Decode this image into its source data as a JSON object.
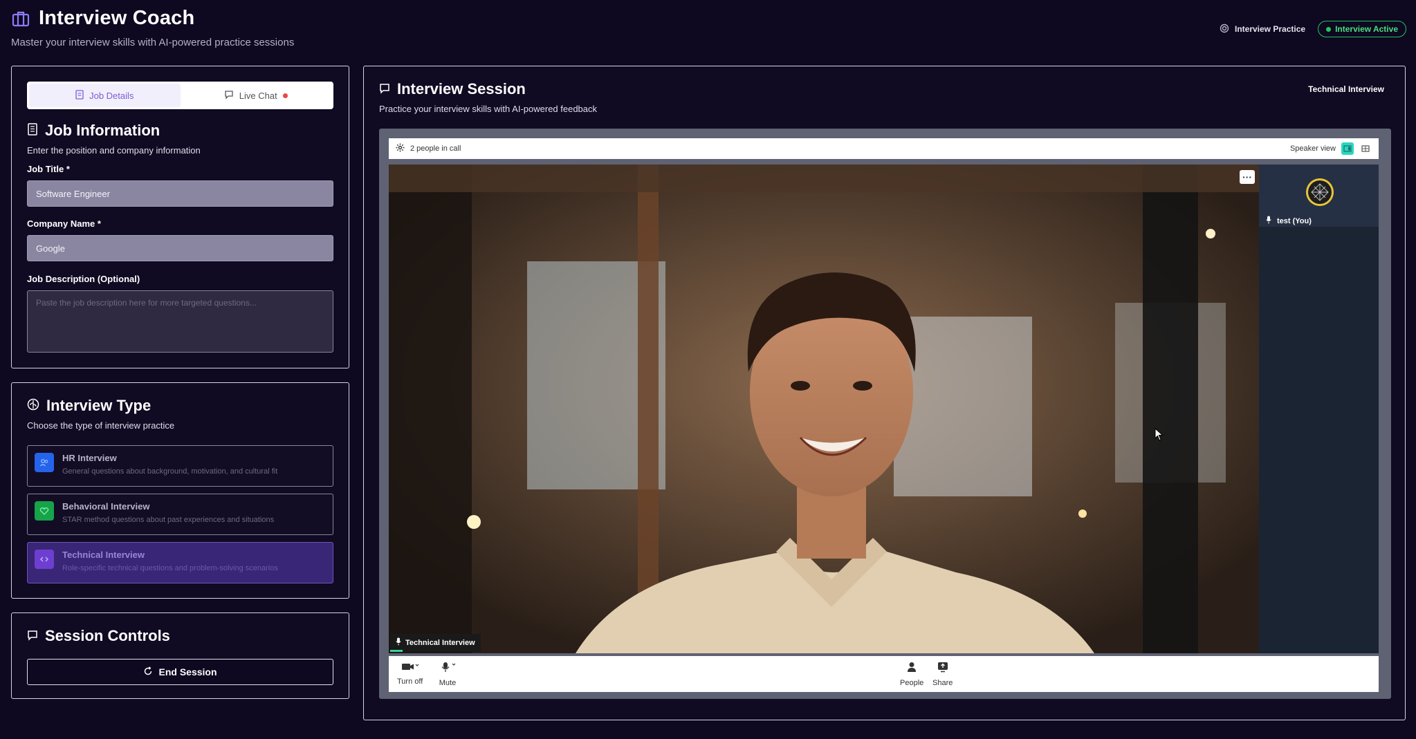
{
  "header": {
    "title": "Interview Coach",
    "subtitle": "Master your interview skills with AI-powered practice sessions",
    "practice_label": "Interview Practice",
    "status_label": "Interview Active"
  },
  "tabs": [
    {
      "label": "Job Details",
      "active": true
    },
    {
      "label": "Live Chat",
      "active": false
    }
  ],
  "job_info": {
    "title": "Job Information",
    "subtitle": "Enter the position and company information",
    "job_title_label": "Job Title *",
    "job_title_value": "Software Engineer",
    "company_label": "Company Name *",
    "company_value": "Google",
    "description_label": "Job Description (Optional)",
    "description_placeholder": "Paste the job description here for more targeted questions..."
  },
  "interview_type": {
    "title": "Interview Type",
    "subtitle": "Choose the type of interview practice",
    "options": [
      {
        "name": "HR Interview",
        "desc": "General questions about background, motivation, and cultural fit",
        "icon": "user-icon",
        "color": "#2563eb",
        "selected": false
      },
      {
        "name": "Behavioral Interview",
        "desc": "STAR method questions about past experiences and situations",
        "icon": "heart-icon",
        "color": "#16a34a",
        "selected": false
      },
      {
        "name": "Technical Interview",
        "desc": "Role-specific technical questions and problem-solving scenarios",
        "icon": "code-icon",
        "color": "#7c3aed",
        "selected": true
      }
    ]
  },
  "session_controls": {
    "title": "Session Controls",
    "end_label": "End Session"
  },
  "session": {
    "title": "Interview Session",
    "subtitle": "Practice your interview skills with AI-powered feedback",
    "type_label": "Technical Interview"
  },
  "call": {
    "people_count": "2 people in call",
    "view_label": "Speaker view",
    "self_name": "test (You)",
    "speaker_name": "Technical Interview",
    "controls": {
      "camera": "Turn off",
      "mute": "Mute",
      "people": "People",
      "share": "Share"
    }
  },
  "colors": {
    "accent": "#7c5cd6",
    "active_green": "#22c55e",
    "background": "#0e0820"
  }
}
